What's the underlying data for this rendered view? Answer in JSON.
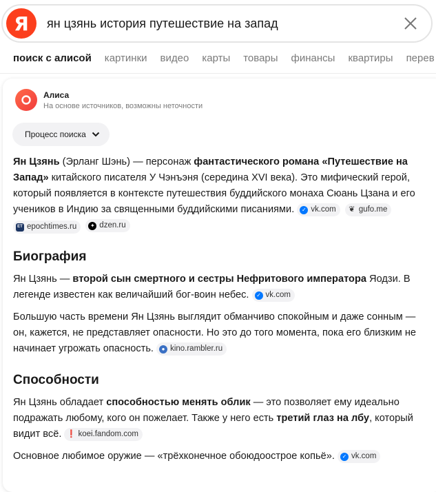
{
  "search": {
    "logo_letter": "Я",
    "query": "ян цзянь история путешествие на запад"
  },
  "tabs": [
    {
      "label": "поиск с алисой",
      "active": true
    },
    {
      "label": "картинки"
    },
    {
      "label": "видео"
    },
    {
      "label": "карты"
    },
    {
      "label": "товары"
    },
    {
      "label": "финансы"
    },
    {
      "label": "квартиры"
    },
    {
      "label": "перев"
    }
  ],
  "alice": {
    "name": "Алиса",
    "subtitle": "На основе источников, возможны неточности",
    "process_label": "Процесс поиска"
  },
  "answer": {
    "p1": {
      "t1": "Ян Цзянь",
      "t2": " (Эрланг Шэнь) — персонаж ",
      "t3": "фантастического романа «Путешествие на Запад»",
      "t4": " китайского писателя У Чэнъэня (середина XVI века). Это мифический герой, который появляется в контексте путешествия буддийского монаха Сюань Цзана и его учеников в Индию за священными буддийскими писаниями.",
      "sources": [
        "vk.com",
        "gufo.me",
        "epochtimes.ru",
        "dzen.ru"
      ]
    },
    "bio_heading": "Биография",
    "p2": {
      "t1": "Ян Цзянь — ",
      "t2": "второй сын смертного и сестры Нефритового императора",
      "t3": " Яодзи. В легенде известен как величайший бог-воин небес.",
      "source": "vk.com"
    },
    "p3": {
      "t1": "Большую часть времени Ян Цзянь выглядит обманчиво спокойным и даже сонным — он, кажется, не представляет опасности. Но это до того момента, пока его близким не начинает угрожать опасность.",
      "source": "kino.rambler.ru"
    },
    "abilities_heading": "Способности",
    "p4": {
      "t1": "Ян Цзянь обладает ",
      "t2": "способностью менять облик",
      "t3": " — это позволяет ему идеально подражать любому, кого он пожелает. Также у него есть ",
      "t4": "третий глаз на лбу",
      "t5": ", который видит всё.",
      "source": "koei.fandom.com"
    },
    "p5": {
      "t1": "Основное любимое оружие — «трёхконечное обоюдоострое копьё».",
      "source": "vk.com"
    }
  },
  "colors": {
    "brand": "#fc3f1d",
    "alice": "#f13c3c",
    "vk": "#0077ff"
  }
}
